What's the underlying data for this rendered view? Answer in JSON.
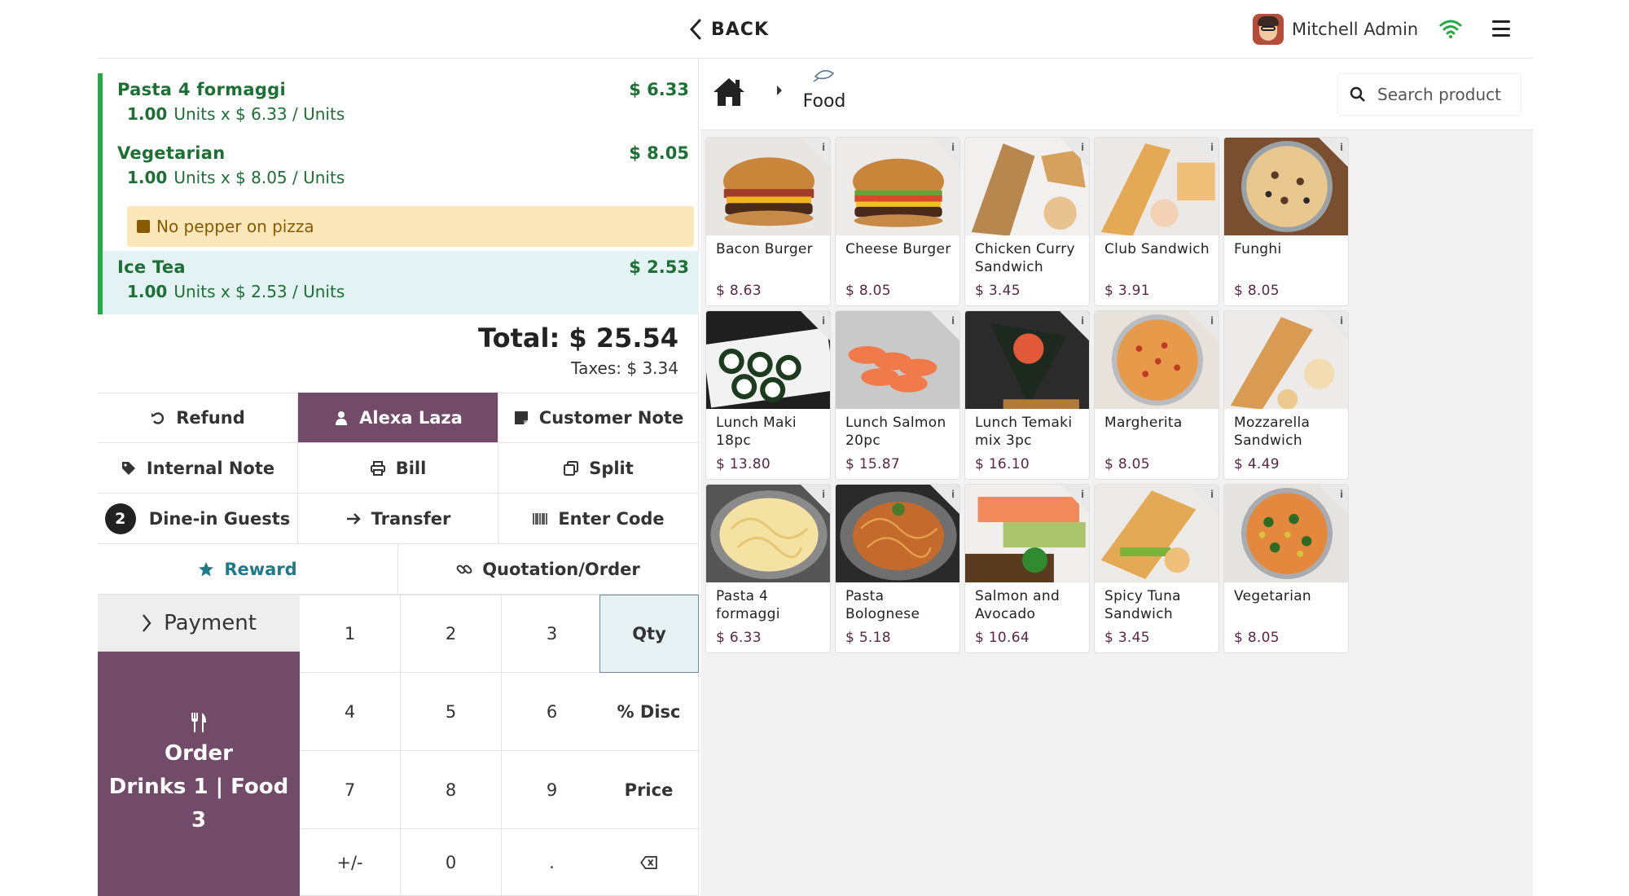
{
  "header": {
    "back_label": "BACK",
    "user_name": "Mitchell Admin"
  },
  "orderlines": [
    {
      "name": "Pasta 4 formaggi",
      "price": "$ 6.33",
      "qty": "1.00",
      "unit_text": "Units x $ 6.33 / Units"
    },
    {
      "name": "Vegetarian",
      "price": "$ 8.05",
      "qty": "1.00",
      "unit_text": "Units x $ 8.05 / Units",
      "note": "No pepper on pizza"
    },
    {
      "name": "Ice Tea",
      "price": "$ 2.53",
      "qty": "1.00",
      "unit_text": "Units x $ 2.53 / Units"
    }
  ],
  "summary": {
    "total": "Total: $ 25.54",
    "taxes": "Taxes: $ 3.34"
  },
  "controls": {
    "refund": "Refund",
    "customer": "Alexa Laza",
    "customer_note": "Customer Note",
    "internal_note": "Internal Note",
    "bill": "Bill",
    "split": "Split",
    "guests_count": "2",
    "guests": "Dine-in Guests",
    "transfer": "Transfer",
    "enter_code": "Enter Code",
    "reward": "Reward",
    "quotation": "Quotation/Order"
  },
  "payment": {
    "label": "Payment"
  },
  "order_button": {
    "line1": "Order",
    "line2": "Drinks 1 | Food",
    "line3": "3"
  },
  "numpad": {
    "keys": [
      "1",
      "2",
      "3",
      "Qty",
      "4",
      "5",
      "6",
      "% Disc",
      "7",
      "8",
      "9",
      "Price",
      "+/-",
      "0",
      ".",
      "⌫"
    ]
  },
  "category": {
    "current": "Food",
    "search_placeholder": "Search product"
  },
  "products": [
    {
      "name": "Bacon Burger",
      "price": "$ 8.63"
    },
    {
      "name": "Cheese Burger",
      "price": "$ 8.05"
    },
    {
      "name": "Chicken Curry Sandwich",
      "price": "$ 3.45"
    },
    {
      "name": "Club Sandwich",
      "price": "$ 3.91"
    },
    {
      "name": "Funghi",
      "price": "$ 8.05"
    },
    {
      "name": "Lunch Maki 18pc",
      "price": "$ 13.80"
    },
    {
      "name": "Lunch Salmon 20pc",
      "price": "$ 15.87"
    },
    {
      "name": "Lunch Temaki mix 3pc",
      "price": "$ 16.10"
    },
    {
      "name": "Margherita",
      "price": "$ 8.05"
    },
    {
      "name": "Mozzarella Sandwich",
      "price": "$ 4.49"
    },
    {
      "name": "Pasta 4 formaggi",
      "price": "$ 6.33"
    },
    {
      "name": "Pasta Bolognese",
      "price": "$ 5.18"
    },
    {
      "name": "Salmon and Avocado",
      "price": "$ 10.64"
    },
    {
      "name": "Spicy Tuna Sandwich",
      "price": "$ 3.45"
    },
    {
      "name": "Vegetarian",
      "price": "$ 8.05"
    }
  ],
  "colors": {
    "accent": "#714b67",
    "orderline_green": "#28a745",
    "note_bg": "#fbe7b9",
    "price_color": "#5a2740"
  }
}
